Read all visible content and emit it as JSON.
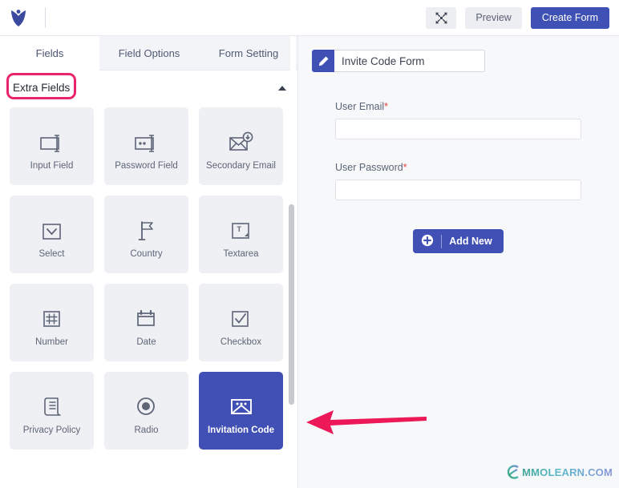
{
  "header": {
    "logo_name": "brand-logo",
    "collapse_icon": "collapse-arrows-icon",
    "preview_label": "Preview",
    "create_form_label": "Create Form",
    "accent_color": "#3f51b5"
  },
  "left_panel": {
    "tabs": [
      {
        "label": "Fields",
        "active": true
      },
      {
        "label": "Field Options",
        "active": false
      },
      {
        "label": "Form Setting",
        "active": false
      }
    ],
    "section": {
      "title": "Extra Fields",
      "collapse_icon": "chevron-up-icon",
      "highlight_color": "#e8246a"
    },
    "tiles": [
      {
        "label": "Input Field",
        "icon": "input-field-icon",
        "selected": false
      },
      {
        "label": "Password Field",
        "icon": "password-field-icon",
        "selected": false
      },
      {
        "label": "Secondary Email",
        "icon": "secondary-email-icon",
        "selected": false
      },
      {
        "label": "Select",
        "icon": "select-dropdown-icon",
        "selected": false
      },
      {
        "label": "Country",
        "icon": "flag-icon",
        "selected": false
      },
      {
        "label": "Textarea",
        "icon": "textarea-icon",
        "selected": false
      },
      {
        "label": "Number",
        "icon": "number-hash-icon",
        "selected": false
      },
      {
        "label": "Date",
        "icon": "calendar-icon",
        "selected": false
      },
      {
        "label": "Checkbox",
        "icon": "checkbox-icon",
        "selected": false
      },
      {
        "label": "Privacy Policy",
        "icon": "document-scroll-icon",
        "selected": false
      },
      {
        "label": "Radio",
        "icon": "radio-button-icon",
        "selected": false
      },
      {
        "label": "Invitation Code",
        "icon": "invitation-mail-icon",
        "selected": true
      }
    ],
    "selected_tile_color": "#4050b5"
  },
  "right_panel": {
    "form_title": {
      "value": "Invite Code Form",
      "placeholder": "Form Title",
      "edit_icon": "pencil-icon"
    },
    "fields": [
      {
        "label": "User Email",
        "required_marker": "*",
        "value": "",
        "placeholder": ""
      },
      {
        "label": "User Password",
        "required_marker": "*",
        "value": "",
        "placeholder": ""
      }
    ],
    "add_new": {
      "label": "Add New",
      "icon": "plus-circle-icon"
    }
  },
  "annotations": {
    "arrow": "left-pointing-arrow",
    "arrow_color": "#ed1857"
  },
  "watermark": {
    "text": "MMOLEARN.COM",
    "icon": "mmolearn-logo-icon"
  }
}
